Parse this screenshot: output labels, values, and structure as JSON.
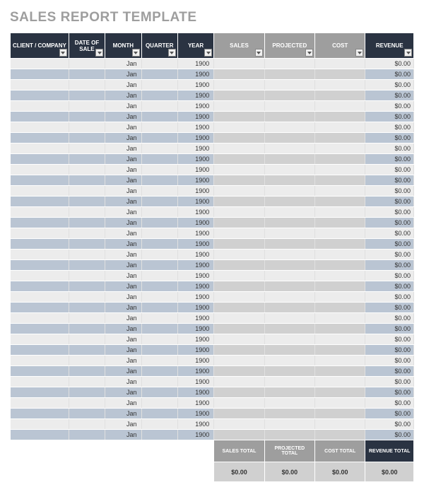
{
  "title": "SALES REPORT TEMPLATE",
  "headers": {
    "client": "CLIENT / COMPANY",
    "date": "DATE OF SALE",
    "month": "MONTH",
    "quarter": "QUARTER",
    "year": "YEAR",
    "sales": "SALES",
    "projected": "PROJECTED",
    "cost": "COST",
    "revenue": "REVENUE"
  },
  "rows": [
    {
      "month": "Jan",
      "year": "1900",
      "revenue": "$0.00"
    },
    {
      "month": "Jan",
      "year": "1900",
      "revenue": "$0.00"
    },
    {
      "month": "Jan",
      "year": "1900",
      "revenue": "$0.00"
    },
    {
      "month": "Jan",
      "year": "1900",
      "revenue": "$0.00"
    },
    {
      "month": "Jan",
      "year": "1900",
      "revenue": "$0.00"
    },
    {
      "month": "Jan",
      "year": "1900",
      "revenue": "$0.00"
    },
    {
      "month": "Jan",
      "year": "1900",
      "revenue": "$0.00"
    },
    {
      "month": "Jan",
      "year": "1900",
      "revenue": "$0.00"
    },
    {
      "month": "Jan",
      "year": "1900",
      "revenue": "$0.00"
    },
    {
      "month": "Jan",
      "year": "1900",
      "revenue": "$0.00"
    },
    {
      "month": "Jan",
      "year": "1900",
      "revenue": "$0.00"
    },
    {
      "month": "Jan",
      "year": "1900",
      "revenue": "$0.00"
    },
    {
      "month": "Jan",
      "year": "1900",
      "revenue": "$0.00"
    },
    {
      "month": "Jan",
      "year": "1900",
      "revenue": "$0.00"
    },
    {
      "month": "Jan",
      "year": "1900",
      "revenue": "$0.00"
    },
    {
      "month": "Jan",
      "year": "1900",
      "revenue": "$0.00"
    },
    {
      "month": "Jan",
      "year": "1900",
      "revenue": "$0.00"
    },
    {
      "month": "Jan",
      "year": "1900",
      "revenue": "$0.00"
    },
    {
      "month": "Jan",
      "year": "1900",
      "revenue": "$0.00"
    },
    {
      "month": "Jan",
      "year": "1900",
      "revenue": "$0.00"
    },
    {
      "month": "Jan",
      "year": "1900",
      "revenue": "$0.00"
    },
    {
      "month": "Jan",
      "year": "1900",
      "revenue": "$0.00"
    },
    {
      "month": "Jan",
      "year": "1900",
      "revenue": "$0.00"
    },
    {
      "month": "Jan",
      "year": "1900",
      "revenue": "$0.00"
    },
    {
      "month": "Jan",
      "year": "1900",
      "revenue": "$0.00"
    },
    {
      "month": "Jan",
      "year": "1900",
      "revenue": "$0.00"
    },
    {
      "month": "Jan",
      "year": "1900",
      "revenue": "$0.00"
    },
    {
      "month": "Jan",
      "year": "1900",
      "revenue": "$0.00"
    },
    {
      "month": "Jan",
      "year": "1900",
      "revenue": "$0.00"
    },
    {
      "month": "Jan",
      "year": "1900",
      "revenue": "$0.00"
    },
    {
      "month": "Jan",
      "year": "1900",
      "revenue": "$0.00"
    },
    {
      "month": "Jan",
      "year": "1900",
      "revenue": "$0.00"
    },
    {
      "month": "Jan",
      "year": "1900",
      "revenue": "$0.00"
    },
    {
      "month": "Jan",
      "year": "1900",
      "revenue": "$0.00"
    },
    {
      "month": "Jan",
      "year": "1900",
      "revenue": "$0.00"
    },
    {
      "month": "Jan",
      "year": "1900",
      "revenue": "$0.00"
    }
  ],
  "totals": {
    "sales_label": "SALES TOTAL",
    "projected_label": "PROJECTED TOTAL",
    "cost_label": "COST TOTAL",
    "revenue_label": "REVENUE TOTAL",
    "sales_value": "$0.00",
    "projected_value": "$0.00",
    "cost_value": "$0.00",
    "revenue_value": "$0.00"
  }
}
